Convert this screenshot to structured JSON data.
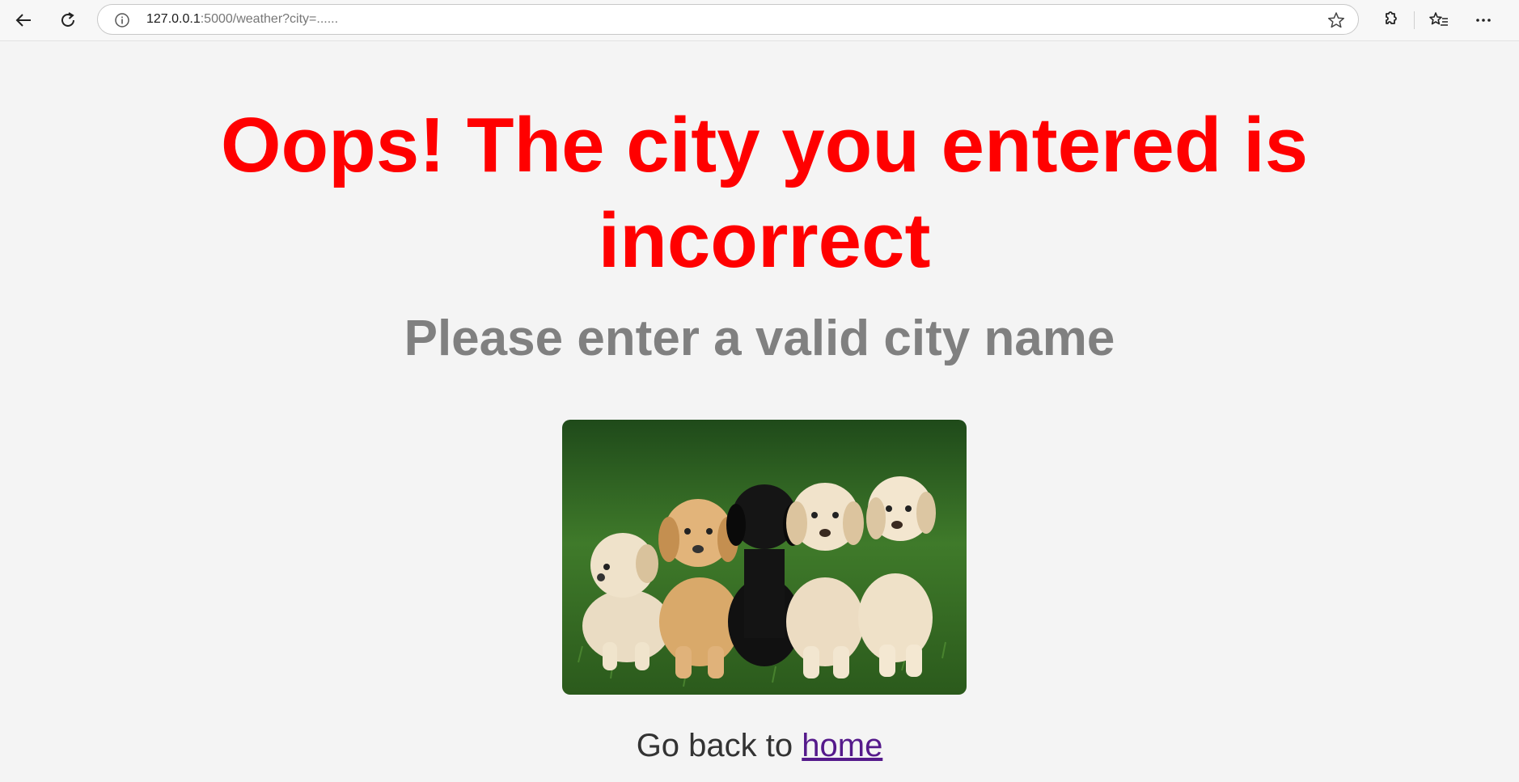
{
  "browser": {
    "url_host": "127.0.0.1",
    "url_rest": ":5000/weather?city=......"
  },
  "page": {
    "headline": "Oops! The city you entered is incorrect",
    "subheadline": "Please enter a valid city name",
    "back_prefix": "Go back to ",
    "back_link": "home"
  },
  "colors": {
    "headline": "#ff0000",
    "subheadline": "#808080",
    "link": "#551a8b",
    "background": "#f4f4f4"
  },
  "icons": [
    "back-arrow-icon",
    "refresh-icon",
    "info-icon",
    "favorite-star-icon",
    "extensions-icon",
    "favorites-icon",
    "more-icon"
  ]
}
